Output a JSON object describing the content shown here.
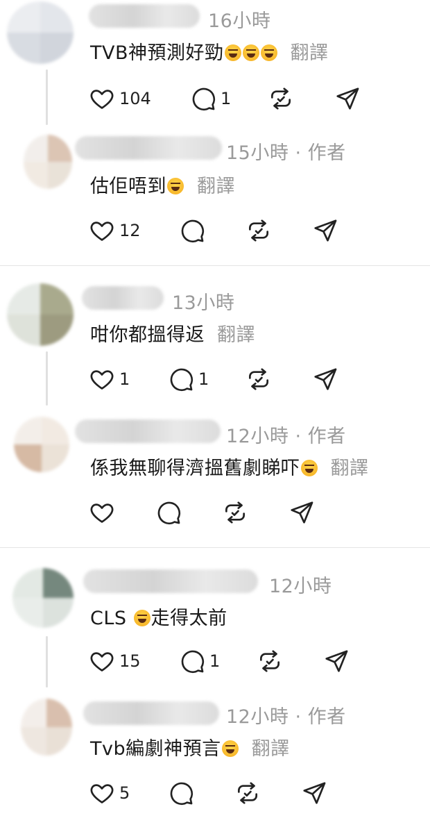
{
  "threads": [
    {
      "comment": {
        "time": "16小時",
        "text": "TVB神預測好勁",
        "emojis": 3,
        "translate": "翻譯",
        "likes": "104",
        "replies": "1",
        "avatar_colors": [
          "#e8eaee",
          "#dfe2e8",
          "#d2d6dd",
          "#c9ced7"
        ]
      },
      "reply": {
        "meta": "15小時 · 作者",
        "text": "估佢唔到",
        "emojis": 1,
        "translate": "翻譯",
        "likes": "12",
        "replies": "",
        "avatar_colors": [
          "#f0ece8",
          "#d6bba8",
          "#efe7de",
          "#e6ddd2"
        ]
      }
    },
    {
      "comment": {
        "time": "13小時",
        "text": "咁你都搵得返",
        "emojis": 0,
        "translate": "翻譯",
        "likes": "1",
        "replies": "1",
        "avatar_colors": [
          "#e2e7e2",
          "#9b9c7a",
          "#d9ddd4",
          "#8c8a6a"
        ]
      },
      "reply": {
        "meta": "12小時 · 作者",
        "text": "係我無聊得濟搵舊劇睇吓",
        "emojis": 1,
        "translate": "翻譯",
        "likes": "",
        "replies": "",
        "avatar_colors": [
          "#f2ece6",
          "#f0e7de",
          "#cfae95",
          "#e8ddd1"
        ]
      }
    },
    {
      "comment": {
        "time": "12小時",
        "text_before": "CLS ",
        "text_after": "走得太前",
        "emojis": 1,
        "translate": "",
        "likes": "15",
        "replies": "1",
        "avatar_colors": [
          "#dfe6e0",
          "#5e7468",
          "#e6ebe7",
          "#d6ddd8"
        ]
      },
      "reply": {
        "meta": "12小時 · 作者",
        "text": "Tvb編劇神預言",
        "emojis": 1,
        "translate": "翻譯",
        "likes": "5",
        "replies": "",
        "avatar_colors": [
          "#f2ece7",
          "#d3b5a0",
          "#ece3db",
          "#e6dbd0"
        ]
      }
    }
  ],
  "icons": {
    "like": "heart-icon",
    "reply": "speech-bubble-icon",
    "repost": "repost-icon",
    "share": "send-icon"
  }
}
